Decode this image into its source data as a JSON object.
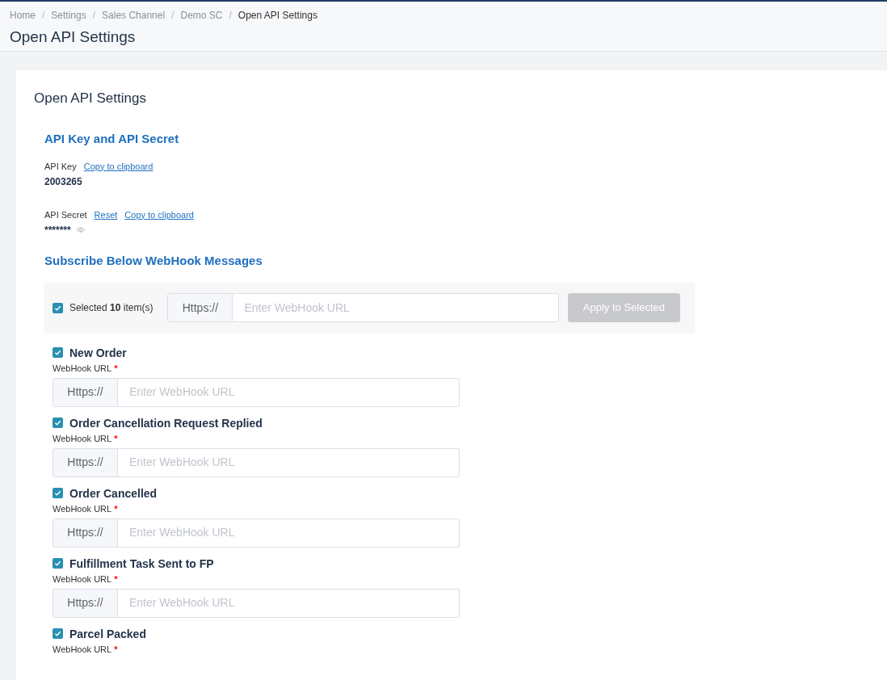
{
  "breadcrumb": [
    {
      "label": "Home",
      "current": false
    },
    {
      "separator": "/",
      "label": "Settings",
      "current": false
    },
    {
      "separator": "/",
      "label": "Sales Channel",
      "current": false
    },
    {
      "separator": "/",
      "label": "Demo SC",
      "current": false
    },
    {
      "separator": "/",
      "label": "Open API Settings",
      "current": true
    }
  ],
  "page_title": "Open API Settings",
  "card_title": "Open API Settings",
  "credentials": {
    "heading": "API Key and API Secret",
    "key": {
      "label": "API Key",
      "links": [
        "Copy to clipboard"
      ],
      "value": "2003265"
    },
    "secret": {
      "label": "API Secret",
      "links": [
        "Reset",
        "Copy to clipboard"
      ],
      "value": "*******"
    }
  },
  "webhooks": {
    "heading": "Subscribe Below WebHook Messages",
    "bulk": {
      "checked": true,
      "label": "Selected **10** item(s)",
      "prefix": "Https://",
      "placeholder": "Enter WebHook URL",
      "button": "Apply to Selected",
      "button_disabled": true
    },
    "items": [
      {
        "title": "New Order",
        "checked": true,
        "label": "WebHook URL",
        "required": "*",
        "prefix": "Https://",
        "placeholder": "Enter WebHook URL"
      },
      {
        "title": "Order Cancellation Request Replied",
        "checked": true,
        "label": "WebHook URL",
        "required": "*",
        "prefix": "Https://",
        "placeholder": "Enter WebHook URL"
      },
      {
        "title": "Order Cancelled",
        "checked": true,
        "label": "WebHook URL",
        "required": "*",
        "prefix": "Https://",
        "placeholder": "Enter WebHook URL"
      },
      {
        "title": "Fulfillment Task Sent to FP",
        "checked": true,
        "label": "WebHook URL",
        "required": "*",
        "prefix": "Https://",
        "placeholder": "Enter WebHook URL"
      },
      {
        "title": "Parcel Packed",
        "checked": true,
        "label": "WebHook URL",
        "required": "*"
      }
    ]
  }
}
